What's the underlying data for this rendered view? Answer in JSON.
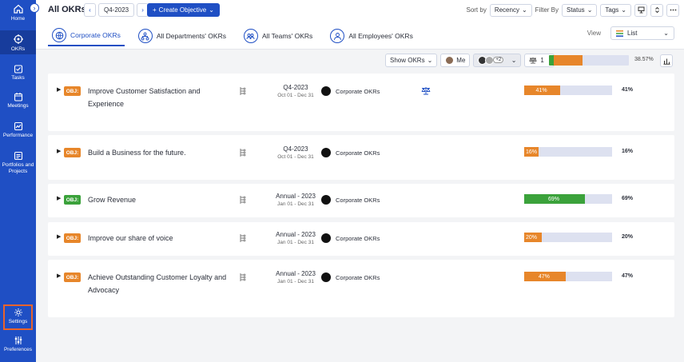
{
  "sidebar": {
    "items": [
      {
        "label": "Home",
        "icon": "home-icon"
      },
      {
        "label": "OKRs",
        "icon": "target-icon"
      },
      {
        "label": "Tasks",
        "icon": "tasks-icon"
      },
      {
        "label": "Meetings",
        "icon": "calendar-icon"
      },
      {
        "label": "Performance",
        "icon": "performance-icon"
      },
      {
        "label": "Portfolios and Projects",
        "icon": "portfolio-icon"
      },
      {
        "label": "Settings",
        "icon": "gear-icon"
      },
      {
        "label": "Preferences",
        "icon": "sliders-icon"
      }
    ],
    "active": "OKRs",
    "toggle": "›"
  },
  "header": {
    "title": "All OKRs",
    "quarter": "Q4-2023",
    "prev": "‹",
    "next": "›",
    "create_label": "Create Objective",
    "sort_by_label": "Sort by",
    "sort_value": "Recency",
    "filter_by_label": "Filter By",
    "status_label": "Status",
    "tags_label": "Tags"
  },
  "tabs": [
    {
      "label": "Corporate OKRs",
      "active": true
    },
    {
      "label": "All Departments' OKRs",
      "active": false
    },
    {
      "label": "All Teams' OKRs",
      "active": false
    },
    {
      "label": "All Employees' OKRs",
      "active": false
    }
  ],
  "view": {
    "label": "View",
    "value": "List"
  },
  "toolbar": {
    "show_okrs": "Show OKRs",
    "me_label": "Me",
    "avatar_extra": "+2",
    "balance_count": "1",
    "overall_pct": "38.57%",
    "overall_green": 0.06,
    "overall_orange": 0.36
  },
  "objectives": [
    {
      "badge": "OBJ:",
      "badge_color": "#e7862a",
      "title": "Improve Customer Satisfaction and Experience",
      "period": "Q4-2023",
      "dates": "Oct 01 - Dec 31",
      "owner": "Corporate OKRs",
      "progress": 41,
      "pct": "41%",
      "bar_color": "#e7862a",
      "balance": true
    },
    {
      "badge": "OBJ:",
      "badge_color": "#e7862a",
      "title": "Build a Business for the future.",
      "period": "Q4-2023",
      "dates": "Oct 01 - Dec 31",
      "owner": "Corporate OKRs",
      "progress": 16,
      "pct": "16%",
      "bar_color": "#e7862a",
      "balance": false
    },
    {
      "badge": "OBJ:",
      "badge_color": "#3ba23b",
      "title": "Grow Revenue",
      "period": "Annual - 2023",
      "dates": "Jan 01 - Dec 31",
      "owner": "Corporate OKRs",
      "progress": 69,
      "pct": "69%",
      "bar_color": "#3ba23b",
      "balance": false
    },
    {
      "badge": "OBJ:",
      "badge_color": "#e7862a",
      "title": "Improve our share of voice",
      "period": "Annual - 2023",
      "dates": "Jan 01 - Dec 31",
      "owner": "Corporate OKRs",
      "progress": 20,
      "pct": "20%",
      "bar_color": "#e7862a",
      "balance": false
    },
    {
      "badge": "OBJ:",
      "badge_color": "#e7862a",
      "title": "Achieve Outstanding Customer Loyalty and Advocacy",
      "period": "Annual - 2023",
      "dates": "Jan 01 - Dec 31",
      "owner": "Corporate OKRs",
      "progress": 47,
      "pct": "47%",
      "bar_color": "#e7862a",
      "balance": false
    }
  ]
}
